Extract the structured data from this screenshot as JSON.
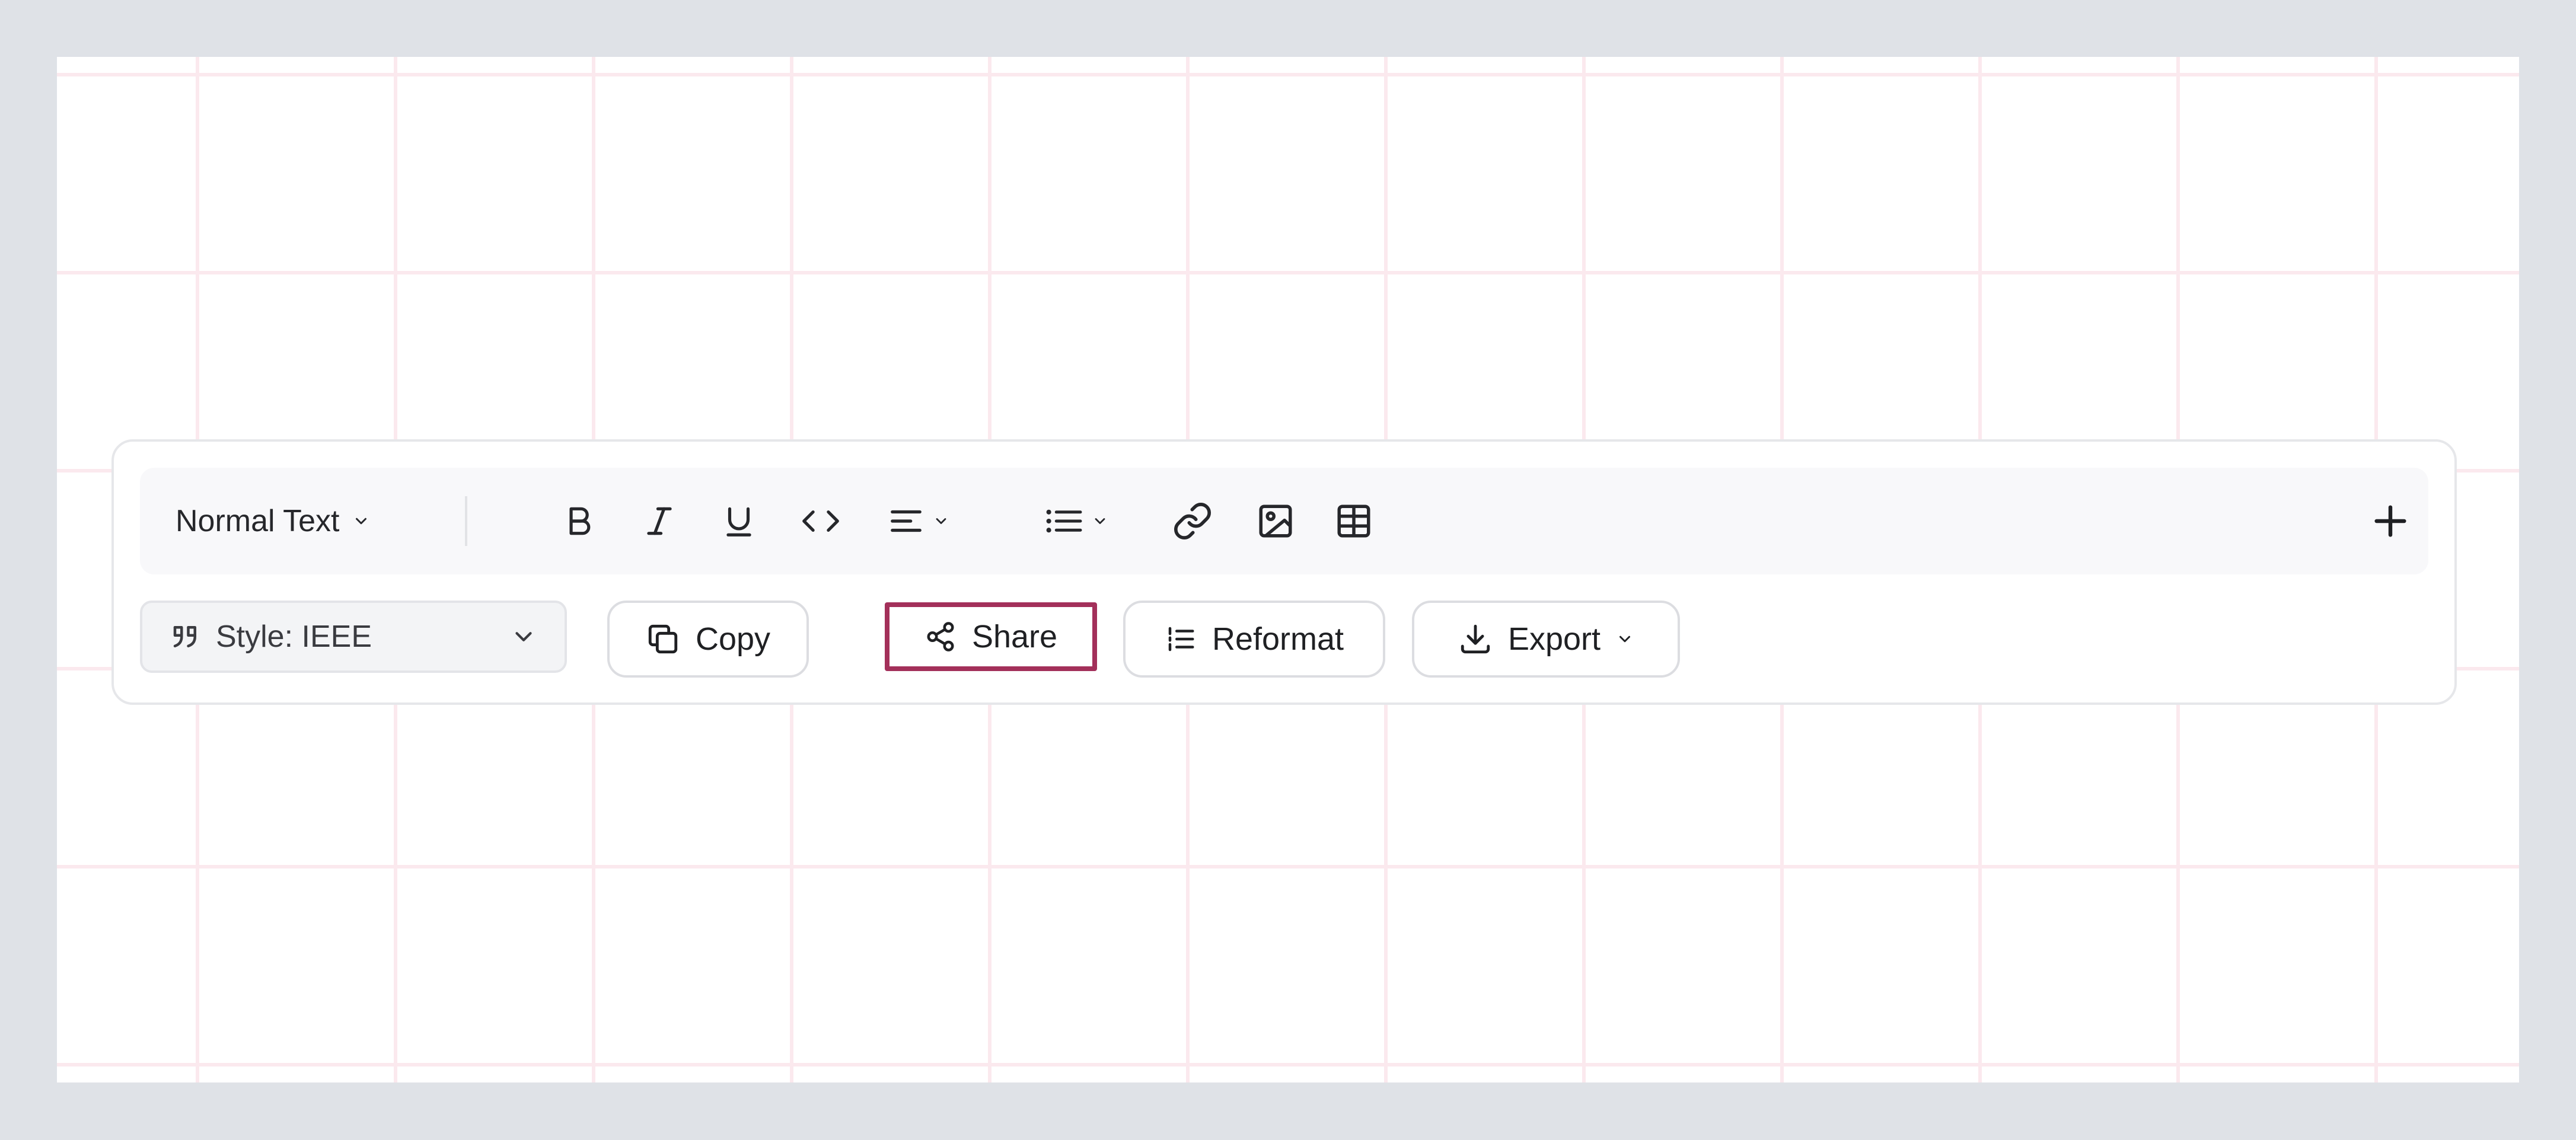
{
  "toolbar": {
    "text_style_label": "Normal Text",
    "icons": [
      "bold-icon",
      "italic-icon",
      "underline-icon",
      "code-icon",
      "align-left-icon",
      "bullet-list-icon",
      "link-icon",
      "image-icon",
      "table-icon",
      "plus-icon"
    ]
  },
  "actions": {
    "style_label": "Style: IEEE",
    "copy_label": "Copy",
    "share_label": "Share",
    "reformat_label": "Reformat",
    "export_label": "Export"
  },
  "colors": {
    "highlight": "#a3305a",
    "grid_line": "#fbe9ee",
    "background": "#dfe2e7"
  }
}
